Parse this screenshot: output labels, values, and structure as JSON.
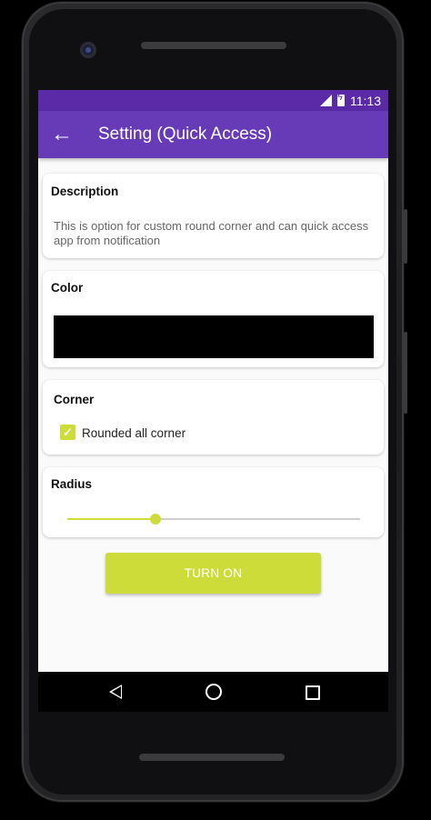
{
  "status_bar": {
    "time": "11:13",
    "signal_icon": "signal-icon",
    "battery_icon": "battery-charging-icon"
  },
  "app_bar": {
    "title": "Setting (Quick Access)",
    "back_icon": "arrow-back-icon"
  },
  "description_card": {
    "heading": "Description",
    "text": "This is option for custom round corner and can quick access app from notification"
  },
  "color_card": {
    "heading": "Color",
    "selected_color": "#000000"
  },
  "corner_card": {
    "heading": "Corner",
    "checkbox_label": "Rounded all corner",
    "checked": true
  },
  "radius_card": {
    "heading": "Radius",
    "slider_value": 0.3
  },
  "action": {
    "button_label": "TURN ON"
  },
  "theme": {
    "primary": "#673ab7",
    "primary_dark": "#5a2aa7",
    "accent": "#cddc39"
  },
  "nav_bar": {
    "back_icon": "nav-back-icon",
    "home_icon": "nav-home-icon",
    "recents_icon": "nav-recents-icon"
  }
}
